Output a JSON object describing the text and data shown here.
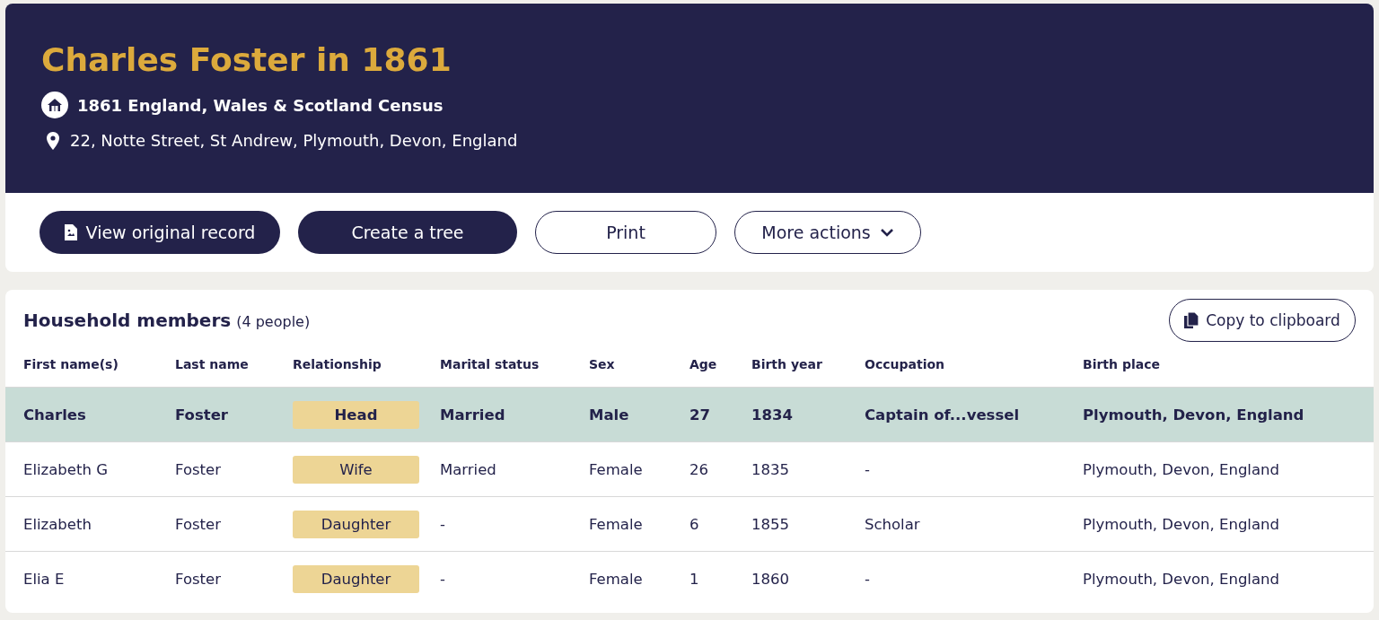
{
  "header": {
    "title": "Charles Foster in 1861",
    "collection": "1861 England, Wales & Scotland Census",
    "address": "22, Notte Street, St Andrew, Plymouth, Devon, England"
  },
  "actions": [
    {
      "label": "View original record",
      "kind": "document"
    },
    {
      "label": "Create a tree",
      "kind": "primary"
    },
    {
      "label": "Print",
      "kind": "outline"
    },
    {
      "label": "More actions",
      "kind": "menu"
    }
  ],
  "household": {
    "title": "Household members",
    "count": "(4 people)",
    "copy_button": "Copy to clipboard",
    "columns": [
      {
        "label": "First name(s)",
        "kind": "text"
      },
      {
        "label": "Last name",
        "kind": "text"
      },
      {
        "label": "Relationship",
        "kind": "badge"
      },
      {
        "label": "Marital status",
        "kind": "text"
      },
      {
        "label": "Sex",
        "kind": "text"
      },
      {
        "label": "Age",
        "kind": "text"
      },
      {
        "label": "Birth year",
        "kind": "text"
      },
      {
        "label": "Occupation",
        "kind": "text"
      },
      {
        "label": "Birth place",
        "kind": "text"
      }
    ],
    "rows": [
      {
        "selected": true,
        "cells": [
          "Charles",
          "Foster",
          "Head",
          "Married",
          "Male",
          "27",
          "1834",
          "Captain of...vessel",
          "Plymouth, Devon, England"
        ]
      },
      {
        "selected": false,
        "cells": [
          "Elizabeth G",
          "Foster",
          "Wife",
          "Married",
          "Female",
          "26",
          "1835",
          "-",
          "Plymouth, Devon, England"
        ]
      },
      {
        "selected": false,
        "cells": [
          "Elizabeth",
          "Foster",
          "Daughter",
          "-",
          "Female",
          "6",
          "1855",
          "Scholar",
          "Plymouth, Devon, England"
        ]
      },
      {
        "selected": false,
        "cells": [
          "Elia E",
          "Foster",
          "Daughter",
          "-",
          "Female",
          "1",
          "1860",
          "-",
          "Plymouth, Devon, England"
        ]
      }
    ]
  }
}
